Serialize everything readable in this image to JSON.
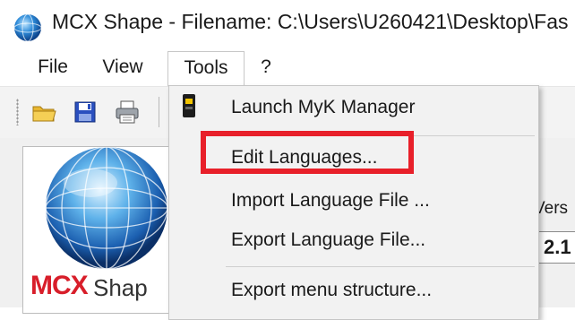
{
  "window": {
    "title": "MCX Shape  -  Filename: C:\\Users\\U260421\\Desktop\\Fas"
  },
  "menubar": {
    "items": [
      "File",
      "View",
      "Tools",
      "?"
    ],
    "active": "Tools"
  },
  "toolbar": {
    "buttons": [
      "open-folder-icon",
      "save-icon",
      "print-icon"
    ]
  },
  "logo": {
    "text_primary": "MCX",
    "text_secondary": "Shap"
  },
  "info_panel": {
    "version_label": "Vers",
    "version_value": "2.1"
  },
  "tools_menu": {
    "items": [
      {
        "label": "Launch MyK Manager",
        "icon": "myk-device-icon"
      },
      {
        "label": "Edit Languages...",
        "highlighted": true
      },
      {
        "label": "Import Language File ..."
      },
      {
        "label": "Export Language File..."
      },
      {
        "label": "Export menu structure..."
      }
    ],
    "highlight_color": "#e8202a"
  }
}
